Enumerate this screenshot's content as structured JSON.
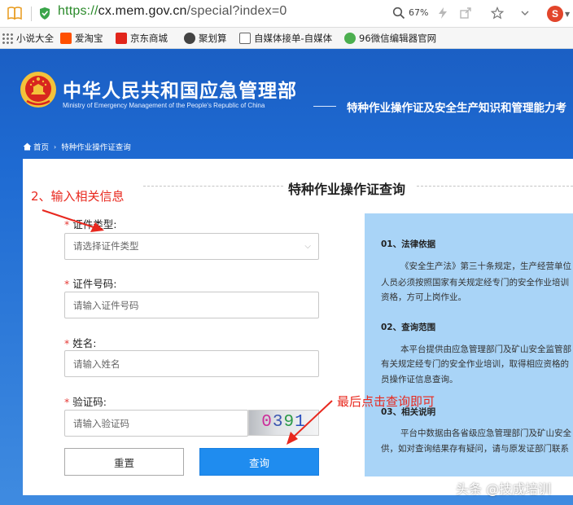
{
  "browser": {
    "url_protocol": "https://",
    "url_rest_host": "cx.mem.gov.cn",
    "url_rest_path": "/special?index=0",
    "zoom": "67%",
    "search_engine_glyph": "S"
  },
  "bookmarks": [
    {
      "label": "小说大全",
      "icon": "grid-icon",
      "color": "#555555"
    },
    {
      "label": "爱淘宝",
      "icon": "taobao-icon",
      "color": "#ff5000"
    },
    {
      "label": "京东商城",
      "icon": "jd-icon",
      "color": "#e1251b"
    },
    {
      "label": "聚划算",
      "icon": "juhuasuan-icon",
      "color": "#333333"
    },
    {
      "label": "自媒体接单-自媒体",
      "icon": "media-icon",
      "color": "#333333"
    },
    {
      "label": "96微信编辑器官网",
      "icon": "wechat-editor-icon",
      "color": "#4caf50"
    }
  ],
  "site": {
    "title": "中华人民共和国应急管理部",
    "subtitle": "Ministry of Emergency Management of the People's Republic of China",
    "slogan": "特种作业操作证及安全生产知识和管理能力考"
  },
  "breadcrumb": {
    "home": "首页",
    "current": "特种作业操作证查询"
  },
  "panel": {
    "title": "特种作业操作证查询"
  },
  "form": {
    "cert_type_label": "证件类型:",
    "cert_type_placeholder": "请选择证件类型",
    "cert_no_label": "证件号码:",
    "cert_no_placeholder": "请输入证件号码",
    "name_label": "姓名:",
    "name_placeholder": "请输入姓名",
    "captcha_label": "验证码:",
    "captcha_placeholder": "请输入验证码",
    "captcha_digits": [
      "0",
      "3",
      "9",
      "1"
    ],
    "reset_label": "重置",
    "query_label": "查询",
    "required_mark": "*"
  },
  "info": {
    "s1_title": "01、法律依据",
    "s1_l1": "《安全生产法》第三十条规定，生产经营单位",
    "s1_l2": "人员必须按照国家有关规定经专门的安全作业培训",
    "s1_l3": "资格，方可上岗作业。",
    "s2_title": "02、查询范围",
    "s2_l1": "本平台提供由应急管理部门及矿山安全监管部",
    "s2_l2": "有关规定经专门的安全作业培训，取得相应资格的",
    "s2_l3": "员操作证信息查询。",
    "s3_title": "03、相关说明",
    "s3_l1": "平台中数据由各省级应急管理部门及矿山安全",
    "s3_l2": "供，如对查询结果存有疑问，请与原发证部门联系"
  },
  "annotations": {
    "step2": "2、输入相关信息",
    "final": "最后点击查询即可",
    "color": "#e8281e"
  },
  "watermark": "头条 @技成培训"
}
